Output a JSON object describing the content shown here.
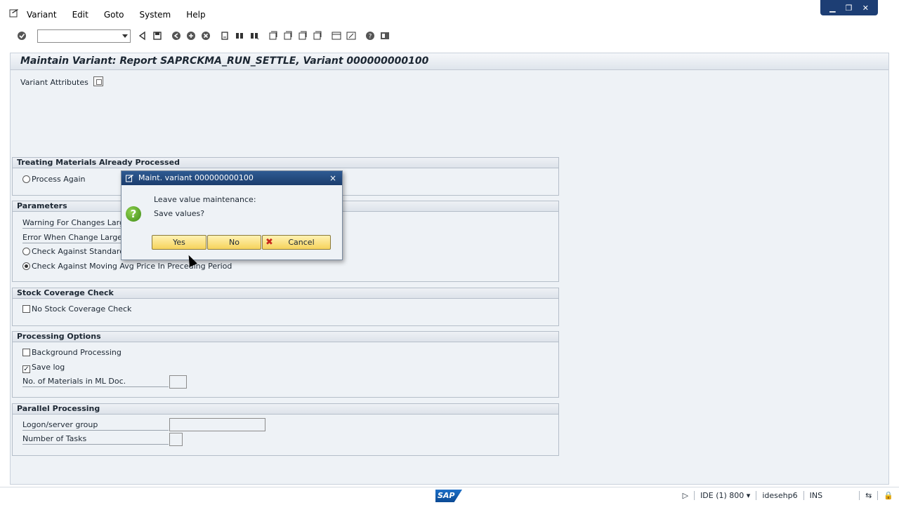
{
  "menubar": {
    "items": [
      {
        "label": "Variant"
      },
      {
        "label": "Edit"
      },
      {
        "label": "Goto"
      },
      {
        "label": "System"
      },
      {
        "label": "Help"
      }
    ],
    "window_controls": [
      "▁",
      "❐",
      "✕"
    ]
  },
  "toolbar": {
    "command_field_value": ""
  },
  "header": {
    "title": "Maintain Variant: Report SAPRCKMA_RUN_SETTLE, Variant 000000000100"
  },
  "app_toolbar": {
    "variant_attributes_label": "Variant Attributes"
  },
  "groups": {
    "treating": {
      "title": "Treating Materials Already Processed",
      "process_again": "Process Again"
    },
    "parameters": {
      "title": "Parameters",
      "warning_label": "Warning For Changes Large",
      "error_label": "Error When Change Larger",
      "check_standard": "Check Against Standard",
      "check_moving_avg": "Check Against Moving Avg Price In Preceding Period"
    },
    "stock": {
      "title": "Stock Coverage Check",
      "no_stock_check": "No Stock Coverage Check"
    },
    "processing": {
      "title": "Processing Options",
      "background": "Background Processing",
      "save_log": "Save log",
      "save_log_checked": "✓",
      "num_materials": "No. of Materials in ML Doc.",
      "num_materials_value": ""
    },
    "parallel": {
      "title": "Parallel Processing",
      "logon_group": "Logon/server group",
      "logon_group_value": "",
      "num_tasks": "Number of Tasks",
      "num_tasks_value": ""
    }
  },
  "dialog": {
    "title": "Maint. variant 000000000100",
    "close": "×",
    "question_icon": "?",
    "line1": "Leave value maintenance:",
    "line2": "Save values?",
    "yes": "Yes",
    "no": "No",
    "cancel": "Cancel",
    "cancel_icon": "✖"
  },
  "statusbar": {
    "logo": "SAP",
    "system": "IDE (1) 800",
    "server": "idesehp6",
    "mode": "INS"
  }
}
